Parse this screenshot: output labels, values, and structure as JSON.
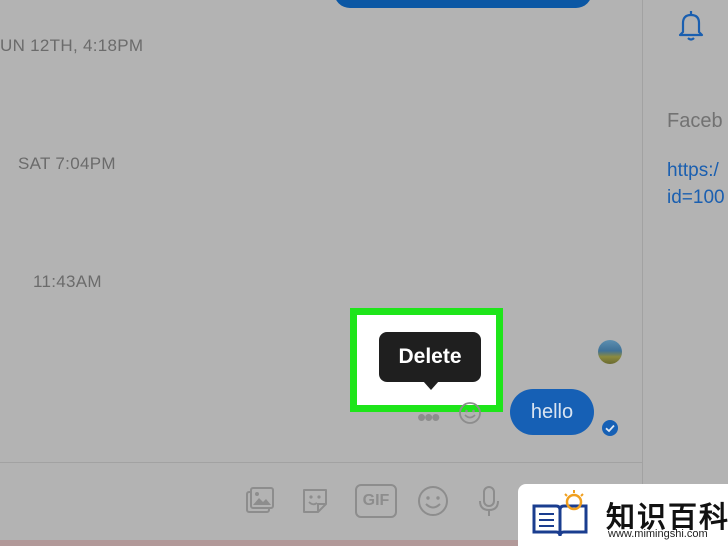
{
  "chat": {
    "timestamps": [
      "UN 12TH, 4:18PM",
      "SAT 7:04PM",
      "11:43AM"
    ],
    "tooltip": "Delete",
    "more_dots": "•••",
    "message": "hello"
  },
  "composer": {
    "icons": [
      "photo-icon",
      "sticker-icon",
      "gif-icon",
      "emoji-icon",
      "microphone-icon"
    ],
    "gif_label": "GIF"
  },
  "sidebar": {
    "label": "Faceb",
    "link_line1": "https:/",
    "link_line2": "id=100"
  },
  "watermark": {
    "title": "知识百科",
    "url": "www.mimingshi.com"
  },
  "colors": {
    "bubble": "#1660b5",
    "highlight": "#1ee51a",
    "tooltip_bg": "#1f1f1f"
  }
}
